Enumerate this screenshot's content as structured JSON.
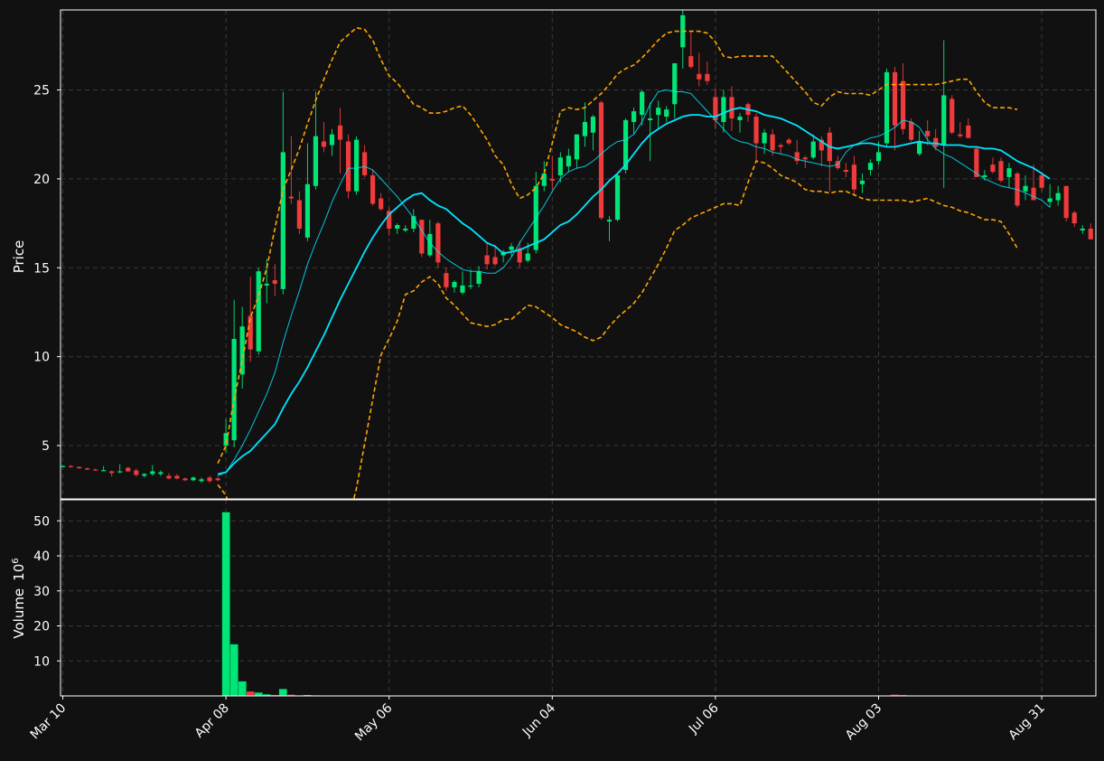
{
  "chart_data": {
    "type": "candlestick",
    "theme": {
      "background": "#111111",
      "grid_color": "#3a3a3a",
      "axes_color": "#ffffff",
      "up_color": "#00e676",
      "down_color": "#ef3b3b",
      "band_color": "#ffa500",
      "ma_color": "#00e5ff"
    },
    "price_panel": {
      "ylabel": "Price",
      "yticks": [
        5,
        10,
        15,
        20,
        25
      ],
      "ylim": [
        2,
        29.5
      ]
    },
    "volume_panel": {
      "ylabel": "Volume",
      "ylabel_exponent": "10",
      "ylabel_power": "6",
      "yticks": [
        10,
        20,
        30,
        40,
        50
      ],
      "ylim": [
        0,
        56
      ]
    },
    "x_ticks": [
      {
        "label": "Mar 10",
        "index": 0
      },
      {
        "label": "Apr 08",
        "index": 20
      },
      {
        "label": "May 06",
        "index": 40
      },
      {
        "label": "Jun 04",
        "index": 60
      },
      {
        "label": "Jul 06",
        "index": 80
      },
      {
        "label": "Aug 03",
        "index": 100
      },
      {
        "label": "Aug 31",
        "index": 120
      }
    ],
    "candles": [
      [
        3.85,
        3.9,
        3.8,
        3.85
      ],
      [
        3.85,
        3.9,
        3.75,
        3.8
      ],
      [
        3.8,
        3.82,
        3.7,
        3.72
      ],
      [
        3.72,
        3.75,
        3.62,
        3.65
      ],
      [
        3.65,
        3.7,
        3.58,
        3.6
      ],
      [
        3.6,
        3.85,
        3.55,
        3.62
      ],
      [
        3.55,
        3.6,
        3.25,
        3.45
      ],
      [
        3.5,
        3.95,
        3.45,
        3.55
      ],
      [
        3.75,
        3.8,
        3.5,
        3.55
      ],
      [
        3.6,
        3.7,
        3.25,
        3.35
      ],
      [
        3.3,
        3.45,
        3.2,
        3.4
      ],
      [
        3.4,
        3.9,
        3.3,
        3.55
      ],
      [
        3.4,
        3.6,
        3.3,
        3.5
      ],
      [
        3.3,
        3.45,
        3.1,
        3.15
      ],
      [
        3.3,
        3.4,
        3.1,
        3.15
      ],
      [
        3.15,
        3.2,
        3.0,
        3.05
      ],
      [
        3.05,
        3.25,
        3.0,
        3.2
      ],
      [
        3.0,
        3.2,
        2.9,
        3.1
      ],
      [
        3.2,
        3.3,
        2.9,
        3.0
      ],
      [
        3.15,
        3.25,
        3.0,
        3.05
      ],
      [
        5.0,
        6.5,
        4.6,
        5.7
      ],
      [
        5.3,
        13.2,
        4.9,
        11.0
      ],
      [
        9.0,
        12.8,
        8.2,
        11.7
      ],
      [
        12.3,
        14.5,
        9.7,
        10.4
      ],
      [
        10.3,
        15.0,
        10.1,
        14.8
      ],
      [
        14.0,
        15.5,
        13.0,
        14.1
      ],
      [
        14.3,
        15.2,
        13.4,
        14.1
      ],
      [
        13.8,
        24.9,
        13.5,
        21.5
      ],
      [
        19.0,
        22.4,
        18.6,
        18.9
      ],
      [
        18.8,
        19.3,
        16.9,
        17.2
      ],
      [
        16.7,
        22.0,
        16.5,
        19.7
      ],
      [
        19.6,
        24.9,
        19.4,
        22.4
      ],
      [
        22.1,
        23.2,
        21.5,
        21.8
      ],
      [
        21.9,
        22.8,
        21.3,
        22.5
      ],
      [
        23.0,
        24.0,
        20.3,
        22.2
      ],
      [
        22.1,
        22.5,
        18.9,
        19.3
      ],
      [
        19.3,
        22.4,
        19.1,
        22.2
      ],
      [
        21.5,
        21.9,
        20.1,
        20.2
      ],
      [
        20.2,
        20.5,
        18.5,
        18.6
      ],
      [
        18.9,
        19.2,
        18.2,
        18.3
      ],
      [
        18.2,
        18.4,
        16.8,
        17.2
      ],
      [
        17.2,
        17.5,
        16.9,
        17.4
      ],
      [
        17.1,
        17.4,
        17.0,
        17.2
      ],
      [
        17.2,
        18.3,
        17.0,
        17.9
      ],
      [
        17.7,
        17.7,
        15.6,
        15.8
      ],
      [
        15.7,
        17.7,
        15.6,
        16.9
      ],
      [
        17.5,
        17.6,
        15.0,
        15.3
      ],
      [
        14.7,
        15.0,
        13.7,
        13.9
      ],
      [
        13.9,
        14.3,
        13.6,
        14.2
      ],
      [
        13.6,
        14.8,
        13.5,
        14.0
      ],
      [
        14.0,
        14.9,
        13.8,
        14.0
      ],
      [
        14.1,
        15.1,
        13.9,
        14.8
      ],
      [
        15.7,
        16.4,
        14.9,
        15.2
      ],
      [
        15.6,
        16.3,
        15.1,
        15.2
      ],
      [
        15.7,
        16.0,
        15.3,
        15.9
      ],
      [
        16.0,
        16.4,
        15.6,
        16.2
      ],
      [
        16.1,
        16.5,
        15.0,
        15.3
      ],
      [
        15.4,
        16.4,
        15.3,
        15.8
      ],
      [
        16.0,
        20.4,
        15.8,
        19.6
      ],
      [
        19.6,
        21.0,
        19.3,
        20.3
      ],
      [
        20.0,
        21.3,
        19.4,
        19.9
      ],
      [
        20.2,
        21.5,
        19.8,
        21.2
      ],
      [
        20.7,
        21.7,
        20.4,
        21.3
      ],
      [
        21.1,
        22.3,
        20.6,
        22.5
      ],
      [
        22.4,
        24.3,
        21.8,
        23.2
      ],
      [
        22.6,
        23.6,
        21.6,
        23.5
      ],
      [
        24.3,
        24.4,
        17.7,
        17.8
      ],
      [
        17.6,
        17.9,
        16.5,
        17.7
      ],
      [
        17.7,
        20.3,
        17.6,
        20.2
      ],
      [
        20.5,
        23.4,
        20.3,
        23.3
      ],
      [
        23.2,
        24.0,
        22.5,
        23.8
      ],
      [
        23.6,
        25.0,
        23.0,
        24.9
      ],
      [
        23.3,
        24.3,
        21.0,
        23.4
      ],
      [
        23.6,
        24.4,
        22.8,
        24.0
      ],
      [
        23.5,
        24.1,
        23.2,
        23.9
      ],
      [
        24.2,
        25.3,
        23.4,
        26.5
      ],
      [
        27.4,
        29.5,
        26.2,
        29.2
      ],
      [
        26.9,
        28.3,
        26.2,
        26.3
      ],
      [
        25.9,
        27.1,
        25.2,
        25.6
      ],
      [
        25.9,
        26.6,
        25.3,
        25.5
      ],
      [
        24.6,
        25.1,
        22.8,
        23.3
      ],
      [
        23.2,
        25.0,
        22.6,
        24.6
      ],
      [
        24.6,
        25.2,
        22.7,
        23.4
      ],
      [
        23.3,
        23.7,
        22.6,
        23.5
      ],
      [
        24.2,
        24.3,
        23.2,
        23.6
      ],
      [
        23.5,
        23.7,
        21.0,
        22.0
      ],
      [
        22.0,
        22.8,
        21.4,
        22.6
      ],
      [
        22.5,
        22.8,
        21.3,
        21.6
      ],
      [
        21.9,
        22.0,
        21.4,
        21.8
      ],
      [
        22.2,
        22.3,
        21.9,
        22.0
      ],
      [
        21.5,
        22.2,
        20.8,
        21.0
      ],
      [
        21.2,
        21.3,
        20.6,
        21.1
      ],
      [
        21.2,
        22.5,
        21.1,
        22.1
      ],
      [
        22.2,
        22.4,
        20.7,
        21.6
      ],
      [
        22.6,
        22.9,
        19.3,
        21.0
      ],
      [
        21.0,
        21.3,
        20.5,
        20.6
      ],
      [
        20.5,
        20.9,
        20.1,
        20.4
      ],
      [
        20.8,
        21.3,
        19.1,
        19.4
      ],
      [
        19.7,
        20.3,
        19.2,
        19.9
      ],
      [
        20.5,
        21.1,
        20.2,
        20.9
      ],
      [
        21.0,
        22.1,
        20.8,
        21.5
      ],
      [
        22.0,
        26.2,
        21.8,
        26.0
      ],
      [
        26.0,
        26.3,
        21.6,
        23.0
      ],
      [
        25.5,
        26.5,
        22.5,
        22.8
      ],
      [
        23.2,
        23.4,
        22.1,
        22.2
      ],
      [
        21.4,
        22.7,
        21.3,
        22.1
      ],
      [
        22.7,
        23.3,
        21.9,
        22.4
      ],
      [
        22.3,
        22.8,
        21.6,
        21.8
      ],
      [
        21.9,
        27.8,
        19.5,
        24.7
      ],
      [
        24.5,
        24.7,
        22.5,
        22.6
      ],
      [
        22.5,
        23.2,
        22.3,
        22.4
      ],
      [
        23.0,
        23.4,
        22.3,
        22.3
      ],
      [
        21.7,
        21.8,
        20.2,
        20.1
      ],
      [
        20.1,
        20.5,
        19.9,
        20.2
      ],
      [
        20.8,
        21.2,
        20.3,
        20.4
      ],
      [
        21.0,
        21.2,
        19.8,
        19.9
      ],
      [
        20.1,
        20.9,
        19.5,
        20.6
      ],
      [
        20.3,
        20.4,
        18.4,
        18.5
      ],
      [
        19.3,
        20.2,
        18.8,
        19.6
      ],
      [
        19.5,
        20.8,
        18.9,
        18.8
      ],
      [
        20.2,
        20.4,
        19.3,
        19.5
      ],
      [
        18.7,
        19.7,
        18.4,
        18.9
      ],
      [
        18.8,
        19.6,
        18.5,
        19.2
      ],
      [
        19.6,
        19.6,
        17.6,
        17.8
      ],
      [
        18.1,
        18.2,
        17.3,
        17.5
      ],
      [
        17.1,
        17.4,
        16.9,
        17.2
      ],
      [
        17.2,
        17.5,
        16.6,
        16.6
      ]
    ],
    "volume": [
      0.1,
      0.1,
      0.1,
      0.1,
      0.1,
      0.1,
      0.1,
      0.1,
      0.1,
      0.1,
      0.1,
      0.1,
      0.1,
      0.1,
      0.1,
      0.1,
      0.1,
      0.1,
      0.1,
      0.1,
      52.5,
      14.8,
      4.2,
      1.3,
      1.0,
      0.5,
      0.3,
      2.0,
      0.4,
      0.2,
      0.3,
      0.2,
      0.1,
      0.1,
      0.1,
      0.1,
      0.1,
      0.1,
      0.1,
      0.1,
      0.1,
      0.1,
      0.1,
      0.1,
      0.1,
      0.1,
      0.1,
      0.1,
      0.1,
      0.1,
      0.1,
      0.1,
      0.1,
      0.1,
      0.1,
      0.1,
      0.1,
      0.1,
      0.1,
      0.1,
      0.1,
      0.1,
      0.1,
      0.1,
      0.1,
      0.1,
      0.1,
      0.1,
      0.1,
      0.1,
      0.1,
      0.1,
      0.1,
      0.1,
      0.1,
      0.1,
      0.1,
      0.1,
      0.1,
      0.1,
      0.1,
      0.1,
      0.1,
      0.1,
      0.1,
      0.1,
      0.1,
      0.1,
      0.1,
      0.1,
      0.1,
      0.1,
      0.1,
      0.1,
      0.1,
      0.1,
      0.1,
      0.1,
      0.1,
      0.1,
      0.1,
      0.1,
      0.4,
      0.3,
      0.2,
      0.1,
      0.1,
      0.1,
      0.1,
      0.1,
      0.1,
      0.1,
      0.1,
      0.1,
      0.1,
      0.1,
      0.1,
      0.1,
      0.1,
      0.1,
      0.1,
      0.1,
      0.1,
      0.1,
      0.1,
      0.1,
      0.1,
      0.1,
      0.1,
      0.1,
      0.1
    ],
    "ma_fast": {
      "start_index": 19,
      "values": [
        3.3,
        3.5,
        4.2,
        5.0,
        5.9,
        6.9,
        7.9,
        9.1,
        10.8,
        12.3,
        13.7,
        15.2,
        16.4,
        17.5,
        18.7,
        19.7,
        20.6,
        20.6,
        20.7,
        20.5,
        20.0,
        19.5,
        19.0,
        18.4,
        17.8,
        17.1,
        16.4,
        15.9,
        15.5,
        15.2,
        14.9,
        14.8,
        14.8,
        14.7,
        14.7,
        15.0,
        15.6,
        16.4,
        17.1,
        17.8,
        18.5,
        19.3,
        20.0,
        20.4,
        20.6,
        20.7,
        21.0,
        21.4,
        21.8,
        22.1,
        22.2,
        22.5,
        23.2,
        24.2,
        24.9,
        25.0,
        24.9,
        24.9,
        24.8,
        24.3,
        23.8,
        23.3,
        22.8,
        22.3,
        22.1,
        22.0,
        21.8,
        21.7,
        21.5,
        21.4,
        21.3,
        21.1,
        21.0,
        20.9,
        20.8,
        20.7,
        20.8,
        21.5,
        21.9,
        22.1,
        22.3,
        22.4,
        22.6,
        22.9,
        23.3,
        23.2,
        22.9,
        22.2,
        21.7,
        21.4,
        21.2,
        20.9,
        20.6,
        20.3,
        20.0,
        19.8,
        19.6,
        19.5,
        19.4,
        19.2,
        19.0,
        18.8,
        18.4
      ]
    },
    "ma_slow": {
      "start_index": 19,
      "values": [
        3.4,
        3.5,
        4.0,
        4.4,
        4.7,
        5.2,
        5.7,
        6.2,
        7.1,
        7.9,
        8.6,
        9.4,
        10.3,
        11.2,
        12.2,
        13.2,
        14.1,
        15.0,
        15.9,
        16.7,
        17.4,
        18.0,
        18.4,
        18.8,
        19.1,
        19.2,
        18.8,
        18.5,
        18.3,
        17.9,
        17.5,
        17.2,
        16.8,
        16.4,
        16.2,
        15.8,
        15.9,
        16.0,
        16.2,
        16.4,
        16.6,
        17.0,
        17.4,
        17.6,
        18.0,
        18.5,
        19.0,
        19.4,
        19.9,
        20.3,
        20.8,
        21.4,
        22.0,
        22.5,
        22.8,
        23.1,
        23.3,
        23.5,
        23.6,
        23.6,
        23.5,
        23.5,
        23.7,
        23.9,
        24.0,
        23.9,
        23.8,
        23.6,
        23.5,
        23.4,
        23.2,
        23.0,
        22.7,
        22.4,
        22.1,
        21.8,
        21.7,
        21.8,
        21.9,
        22.0,
        22.0,
        21.9,
        21.8,
        21.8,
        21.9,
        22.0,
        22.1,
        22.0,
        22.0,
        21.9,
        21.9,
        21.9,
        21.8,
        21.8,
        21.7,
        21.7,
        21.6,
        21.3,
        21.0,
        20.8,
        20.6,
        20.3,
        20.0
      ]
    },
    "bb_upper": {
      "start_index": 19,
      "values": [
        4.0,
        5.0,
        7.6,
        9.8,
        12.2,
        13.4,
        15.0,
        17.2,
        19.4,
        20.5,
        21.7,
        23.1,
        24.4,
        25.6,
        26.7,
        27.7,
        28.1,
        28.5,
        28.4,
        27.8,
        26.7,
        25.8,
        25.4,
        24.8,
        24.2,
        24.0,
        23.7,
        23.7,
        23.8,
        24.0,
        24.1,
        23.6,
        22.9,
        22.2,
        21.3,
        20.8,
        19.7,
        18.9,
        19.1,
        19.5,
        20.3,
        22.0,
        23.8,
        24.0,
        23.9,
        24.0,
        24.4,
        24.8,
        25.3,
        25.9,
        26.2,
        26.4,
        26.8,
        27.3,
        27.8,
        28.2,
        28.3,
        28.3,
        28.3,
        28.3,
        28.2,
        27.7,
        26.9,
        26.8,
        26.9,
        26.9,
        26.9,
        26.9,
        26.9,
        26.4,
        25.9,
        25.4,
        24.9,
        24.3,
        24.1,
        24.6,
        24.9,
        24.8,
        24.8,
        24.8,
        24.7,
        25.0,
        25.3,
        25.3,
        25.3,
        25.3,
        25.3,
        25.3,
        25.3,
        25.4,
        25.5,
        25.6,
        25.6,
        24.9,
        24.3,
        24.0,
        24.0,
        24.0,
        23.9
      ]
    },
    "bb_lower": {
      "start_index": 19,
      "values": [
        2.8,
        2.2,
        0.8,
        -0.8,
        -2.5,
        -3.3,
        -4.5,
        -5.2,
        -5.6,
        -5.7,
        -6.1,
        -5.4,
        -4.5,
        -3.3,
        -2.1,
        -0.7,
        0.8,
        2.6,
        5.1,
        7.6,
        10.1,
        11.0,
        12.0,
        13.5,
        13.7,
        14.2,
        14.5,
        14.1,
        13.3,
        12.9,
        12.4,
        11.9,
        11.8,
        11.7,
        11.8,
        12.1,
        12.1,
        12.5,
        12.9,
        12.8,
        12.5,
        12.2,
        11.8,
        11.6,
        11.4,
        11.1,
        10.9,
        11.1,
        11.7,
        12.2,
        12.6,
        13.0,
        13.6,
        14.4,
        15.2,
        16.1,
        17.1,
        17.4,
        17.8,
        18.0,
        18.2,
        18.4,
        18.6,
        18.6,
        18.5,
        19.8,
        21.0,
        20.9,
        20.6,
        20.2,
        20.0,
        19.8,
        19.4,
        19.3,
        19.3,
        19.2,
        19.3,
        19.3,
        19.1,
        18.9,
        18.8,
        18.8,
        18.8,
        18.8,
        18.8,
        18.7,
        18.8,
        18.9,
        18.7,
        18.5,
        18.4,
        18.2,
        18.1,
        17.9,
        17.7,
        17.7,
        17.6,
        16.9,
        16.1
      ]
    }
  }
}
